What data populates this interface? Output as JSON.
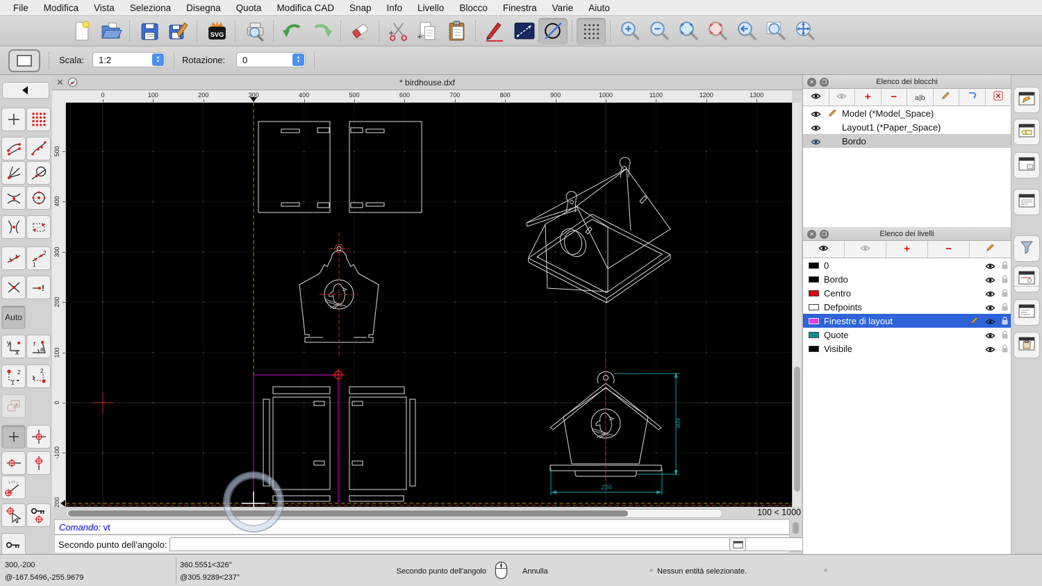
{
  "menubar": {
    "items": [
      "File",
      "Modifica",
      "Vista",
      "Seleziona",
      "Disegna",
      "Quota",
      "Modifica CAD",
      "Snap",
      "Info",
      "Livello",
      "Blocco",
      "Finestra",
      "Varie",
      "Aiuto"
    ]
  },
  "main_toolbar": {
    "groups": [
      [
        "new-document",
        "open-file"
      ],
      [
        "save",
        "save-as"
      ],
      [
        "svg-export"
      ],
      [
        "print-preview"
      ],
      [
        "undo",
        "redo"
      ],
      [
        "delete"
      ],
      [
        "cut",
        "copy",
        "paste"
      ],
      [
        "draw-pencil",
        "line-tool",
        "circle-slash-tool"
      ],
      [
        "grid-toggle"
      ],
      [
        "zoom-in",
        "zoom-out",
        "zoom-auto",
        "zoom-selection",
        "zoom-previous",
        "zoom-window",
        "pan"
      ]
    ],
    "pressed": [
      "circle-slash-tool",
      "grid-toggle"
    ]
  },
  "tool_options": {
    "scale_label": "Scala:",
    "scale_value": "1:2",
    "rotation_label": "Rotazione:",
    "rotation_value": "0"
  },
  "document_tab": {
    "title": "* birdhouse.dxf",
    "close_glyph": "✕"
  },
  "rulers": {
    "horizontal": [
      "0",
      "100",
      "200",
      "300",
      "400",
      "500",
      "600",
      "700",
      "800",
      "900",
      "1000",
      "1100",
      "1200",
      "1300"
    ],
    "vertical": [
      "500",
      "400",
      "300",
      "200",
      "100",
      "0",
      "-100",
      "-200"
    ],
    "h_marker_value": "300",
    "v_marker_value": "-200"
  },
  "canvas": {
    "grid_status": "100 < 1000",
    "dim_width": "220",
    "dim_height": "309"
  },
  "command_line": {
    "history_label": "Comando:",
    "history_command": "vt",
    "prompt": "Secondo punto dell'angolo:",
    "input_value": ""
  },
  "status_bar": {
    "coord_absolute": "300,-200",
    "coord_relative": "@-167.5496,-255.9679",
    "polar_absolute": "360.5551<326°",
    "polar_relative": "@305.9289<237°",
    "mouse_left_hint": "Secondo punto dell'angolo",
    "mouse_right_hint": "Annulla",
    "selection_info": "Nessun entità selezionate."
  },
  "block_panel": {
    "title": "Elenco dei blocchi",
    "toolbar": [
      "show-all-blocks",
      "hide-all-blocks",
      "add-block",
      "remove-block",
      "rename-block",
      "edit-block",
      "insert-block",
      "delete-block"
    ],
    "rename_icon_text": "a|b",
    "blocks": [
      {
        "label": "Model (*Model_Space)",
        "editing": true,
        "selected": false
      },
      {
        "label": "Layout1 (*Paper_Space)",
        "editing": false,
        "selected": false
      },
      {
        "label": "Bordo",
        "editing": false,
        "selected": true
      }
    ]
  },
  "layer_panel": {
    "title": "Elenco dei livelli",
    "toolbar": [
      "show-all-layers",
      "hide-all-layers",
      "add-layer",
      "remove-layer",
      "edit-layer"
    ],
    "layers": [
      {
        "label": "0",
        "color": "#000000",
        "selected": false,
        "editing": false
      },
      {
        "label": "Bordo",
        "color": "#000000",
        "selected": false,
        "editing": false
      },
      {
        "label": "Centro",
        "color": "#e00000",
        "selected": false,
        "editing": false
      },
      {
        "label": "Defpoints",
        "color": "#ffffff",
        "selected": false,
        "editing": false
      },
      {
        "label": "Finestre di layout",
        "color": "#e33fe3",
        "selected": true,
        "editing": true
      },
      {
        "label": "Quote",
        "color": "#0d8f8f",
        "selected": false,
        "editing": false
      },
      {
        "label": "Visibile",
        "color": "#000000",
        "selected": false,
        "editing": false
      }
    ]
  },
  "right_strip": {
    "icons": [
      "property-editor-panel",
      "block-list-panel",
      "layer-list-panel",
      "library-browser-panel",
      "selection-filter-panel",
      "pattern-panel",
      "command-line-panel",
      "clipboard-panel"
    ]
  },
  "snap_toolbar": {
    "auto_label": "Auto",
    "rows": [
      [
        "back"
      ],
      [
        "snap-free",
        "snap-grid"
      ],
      [
        "snap-endpoints",
        "snap-on-entity"
      ],
      [
        "snap-perpendicular",
        "snap-tangential"
      ],
      [
        "snap-middle",
        "snap-center"
      ],
      [
        "snap-intersection",
        "snap-reference"
      ],
      [
        "snap-distance",
        "snap-distance-manual"
      ],
      [
        "snap-intersection-x",
        "snap-intersection-manual"
      ],
      [
        "auto-snap"
      ],
      [
        "coordinate-cartesian",
        "coordinate-polar"
      ],
      [
        "relative-cartesian",
        "relative-polar"
      ],
      [
        "restrict-orthogonal"
      ],
      [
        "restrict-none",
        "restrict-both"
      ],
      [
        "restrict-horizontal",
        "restrict-vertical"
      ],
      [
        "restrict-angle"
      ],
      [
        "set-relative-zero",
        "lock-relative-zero"
      ],
      [
        "relative-zero-key"
      ]
    ],
    "pressed": [
      "auto-snap",
      "restrict-none"
    ],
    "disabled": [
      "restrict-orthogonal"
    ]
  },
  "colors": {
    "selection_blue": "#2e63d9",
    "viewport_magenta": "#b400b4",
    "dimension_teal": "#10a0a0",
    "centerline_red": "#c03030",
    "crosshair_orange": "#ac9000",
    "canvas_background": "#000000"
  }
}
